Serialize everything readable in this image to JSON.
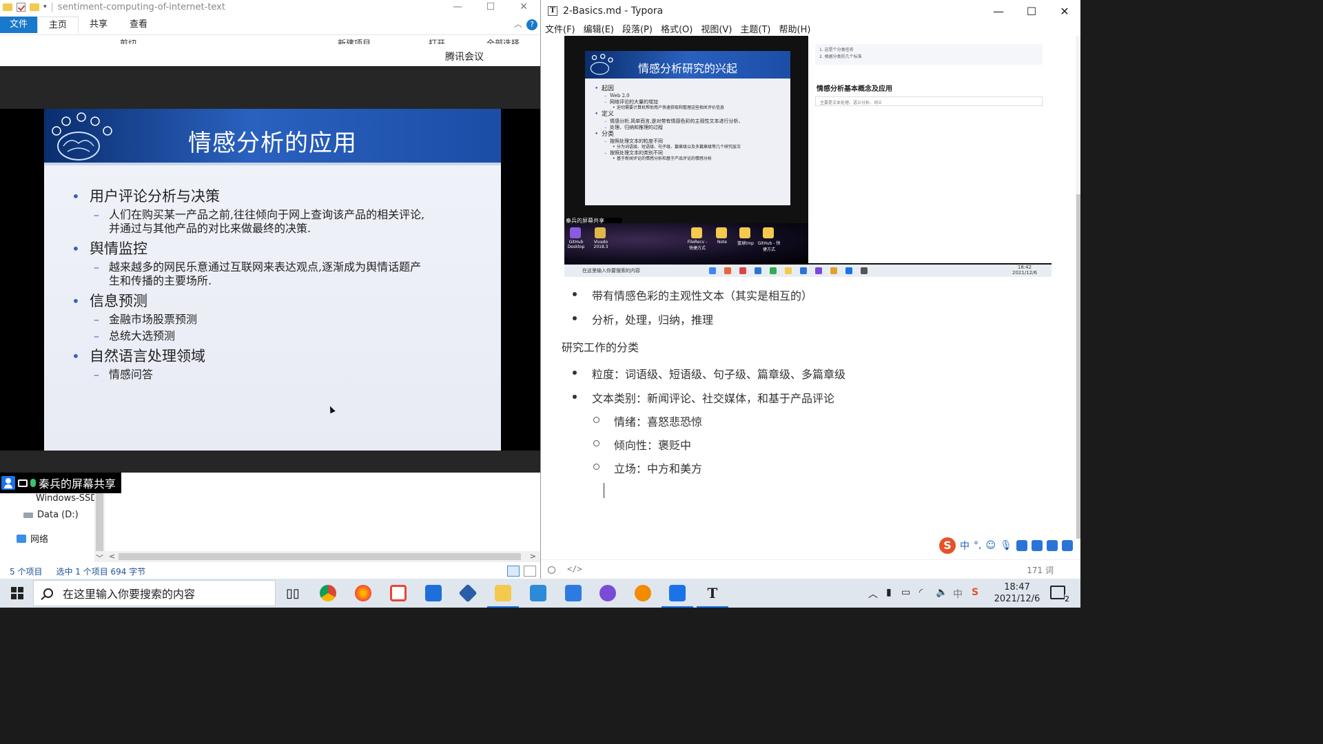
{
  "explorer": {
    "title": "sentiment-computing-of-internet-text",
    "tabs": [
      "文件",
      "主页",
      "共享",
      "查看"
    ],
    "ribbon_fragments": [
      "剪切",
      "新建项目",
      "打开",
      "全部选择"
    ],
    "nav": [
      "Windows-SSD",
      "Data (D:)",
      "网络"
    ],
    "status": {
      "count": "5 个项目",
      "selected": "选中 1 个项目  694 字节"
    }
  },
  "meeting": {
    "title": "腾讯会议",
    "sharer": "秦兵的屏幕共享",
    "slide": {
      "title": "情感分析的应用",
      "items": [
        {
          "text": "用户评论分析与决策",
          "subs": [
            "人们在购买某一产品之前,往往倾向于网上查询该产品的相关评论,",
            "并通过与其他产品的对比来做最终的决策."
          ]
        },
        {
          "text": "舆情监控",
          "subs": [
            "越来越多的网民乐意通过互联网来表达观点,逐渐成为舆情话题产",
            "生和传播的主要场所."
          ]
        },
        {
          "text": "信息预测",
          "subs": [
            "金融市场股票预测",
            "总统大选预测"
          ]
        },
        {
          "text": "自然语言处理领域",
          "subs": [
            "情感问答"
          ]
        }
      ]
    }
  },
  "typora": {
    "title": "2-Basics.md - Typora",
    "menu": [
      "文件(F)",
      "编辑(E)",
      "段落(P)",
      "格式(O)",
      "视图(V)",
      "主题(T)",
      "帮助(H)"
    ],
    "embedded": {
      "slide_title": "情感分析研究的兴起",
      "lines": [
        {
          "lvl": 1,
          "t": "起因"
        },
        {
          "lvl": 2,
          "t": "Web 2.0"
        },
        {
          "lvl": 2,
          "t": "网络评论的大量的增加"
        },
        {
          "lvl": 3,
          "t": "迫切需要计算机帮助用户快速获取和整理这些相关评价信息"
        },
        {
          "lvl": 1,
          "t": "定义"
        },
        {
          "lvl": 2,
          "t": "情感分析,简单而言,是对带有情感色彩的主观性文本进行分析、"
        },
        {
          "lvl": 2,
          "t": "处理、归纳和推理的过程"
        },
        {
          "lvl": 1,
          "t": "分类"
        },
        {
          "lvl": 2,
          "t": "按照处理文本的粒度不同"
        },
        {
          "lvl": 3,
          "t": "分为词语级、短语级、句子级、篇章级以及多篇章级等几个研究层次"
        },
        {
          "lvl": 2,
          "t": "按照处理文本的类别不同"
        },
        {
          "lvl": 3,
          "t": "基于新闻评论的情感分析和基于产品评论的情感分析"
        }
      ],
      "sharer": "秦兵的屏幕共享",
      "desktop_icons": [
        "GitHub Desktop",
        "Vivado 2018.3",
        "FileRecv - 快捷方式",
        "Note",
        "篮球tmp",
        "GitHub - 快捷方式"
      ],
      "right_box": [
        "1. 这是个分类任务",
        "2. 根据分类的几个标准"
      ],
      "right_heading": "情感分析基本概念及应用",
      "right_input": "主要是文本处理、语义分析、词义",
      "taskbar_search": "在这里输入你要搜索的内容",
      "time": "18:42",
      "date": "2021/12/6"
    },
    "doc": {
      "bullets1": [
        "带有情感色彩的主观性文本（其实是相互的）",
        "分析，处理，归纳，推理"
      ],
      "heading": "研究工作的分类",
      "bullets2": [
        "粒度：词语级、短语级、句子级、篇章级、多篇章级",
        "文本类别：新闻评论、社交媒体，和基于产品评论"
      ],
      "sub": [
        "情绪：喜怒悲恐惊",
        "倾向性：褒贬中",
        "立场：中方和美方"
      ]
    },
    "status": {
      "code_icon": "</>",
      "words": "171 词"
    },
    "ime": "中"
  },
  "taskbar": {
    "search_placeholder": "在这里输入你要搜索的内容",
    "apps": [
      "task-view",
      "chrome",
      "firefox",
      "gmail",
      "mail",
      "virtualbox",
      "file-explorer",
      "vscode",
      "wps-writer",
      "github-desktop",
      "search-tool",
      "tencent-meeting",
      "typora"
    ],
    "tray_ime": "中",
    "time": "18:47",
    "date": "2021/12/6",
    "notif_count": "2"
  },
  "colors": {
    "accent": "#1979ca",
    "slide_blue": "#1b4da6",
    "taskbar": "#dfe6ee"
  }
}
